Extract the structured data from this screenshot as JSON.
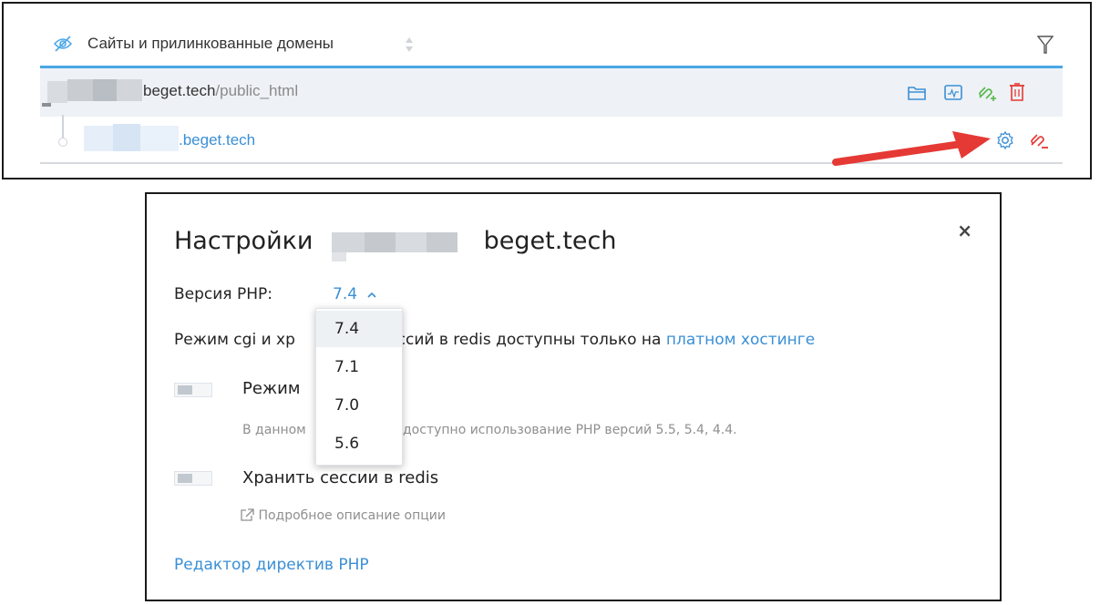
{
  "sites_table": {
    "header_title": "Сайты и прилинкованные домены",
    "rows": [
      {
        "domain": "beget.tech",
        "path": "/public_html"
      },
      {
        "domain": ".beget.tech"
      }
    ]
  },
  "icons": {
    "header": [
      "eye-slash-icon",
      "sort-icon",
      "filter-icon"
    ],
    "main_row": [
      "folder-icon",
      "monitor-icon",
      "link-add-icon",
      "trash-icon"
    ],
    "sub_row": [
      "gear-icon",
      "link-remove-icon"
    ]
  },
  "colors": {
    "accent": "#3b8fd6",
    "header_border": "#4aa7e6",
    "green_icon": "#56b84a",
    "red_icon": "#e53935",
    "arrow": "#e53935"
  },
  "modal": {
    "title": "Настройки",
    "title_domain": "beget.tech",
    "close": "×",
    "php_label": "Версия PHP:",
    "php_version": "7.4",
    "notice_text": "Режим cgi и хр",
    "notice_text_tail": "сессий в redis доступны только на",
    "notice_link": "платном хостинге",
    "cgi_option": {
      "label": "Режим",
      "hint_left": "В данном",
      "hint_right": "доступно использование PHP версий 5.5, 5.4, 4.4."
    },
    "redis_option": {
      "label": "Хранить сессии в redis",
      "hint": "Подробное описание опции"
    },
    "editor_link": "Редактор директив PHP"
  },
  "php_dropdown": {
    "options": [
      "7.4",
      "7.1",
      "7.0",
      "5.6"
    ],
    "selected": "7.4"
  }
}
